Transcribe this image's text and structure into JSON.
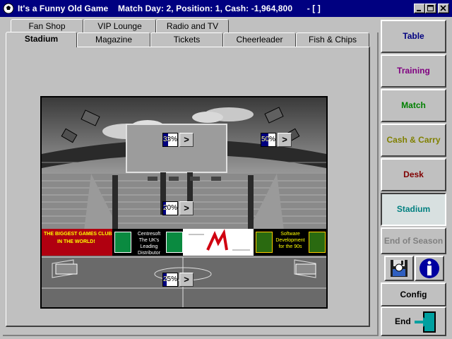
{
  "window": {
    "title": "It's a Funny Old Game    Match Day: 2, Position: 1, Cash: -1,964,800      - [ ]"
  },
  "tabs_back": [
    "Fan Shop",
    "VIP Lounge",
    "Radio and TV"
  ],
  "tabs_front": [
    "Stadium",
    "Magazine",
    "Tickets",
    "Cheerleader",
    "Fish & Chips"
  ],
  "active_tab": "Stadium",
  "stadium": {
    "upgrades": [
      {
        "name": "scoreboard",
        "value": "33%",
        "level": 0.33,
        "button": ">"
      },
      {
        "name": "floodlights",
        "value": "50%",
        "level": 0.5,
        "button": ">"
      },
      {
        "name": "stands",
        "value": "20%",
        "level": 0.2,
        "button": ">"
      },
      {
        "name": "pitch",
        "value": "25%",
        "level": 0.25,
        "button": ">"
      }
    ],
    "ads": {
      "games_club_line1": "THE BIGGEST GAMES CLUB",
      "games_club_line2": "IN THE WORLD!",
      "centresoft": "Centresoft The UK's Leading Distributor",
      "software": "Software Development for the 90s"
    }
  },
  "menu": {
    "items": [
      {
        "label": "Table",
        "color": "#000080"
      },
      {
        "label": "Training",
        "color": "#800080"
      },
      {
        "label": "Match",
        "color": "#008000"
      },
      {
        "label": "Cash & Carry",
        "color": "#808000"
      },
      {
        "label": "Desk",
        "color": "#800000"
      },
      {
        "label": "Stadium",
        "color": "#008080"
      },
      {
        "label": "End of Season",
        "color": "#808080"
      }
    ],
    "config": "Config",
    "end": "End"
  }
}
